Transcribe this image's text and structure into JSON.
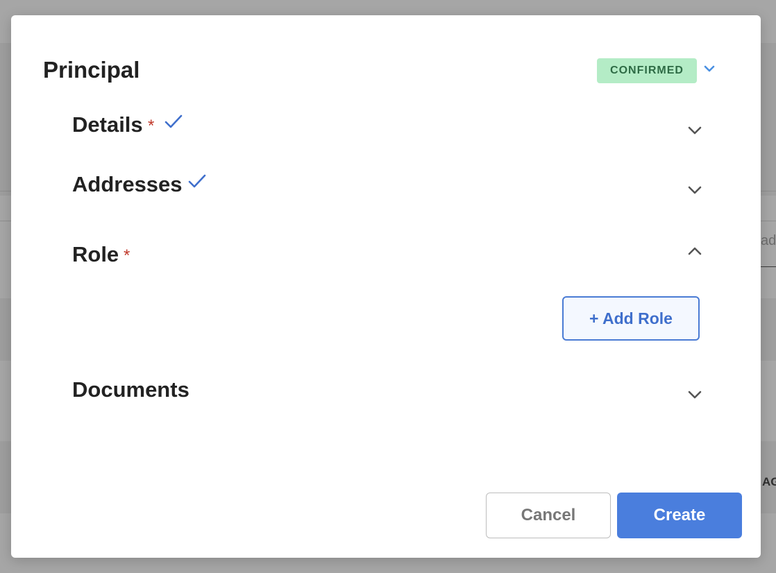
{
  "background": {
    "partial_text_right": "ad",
    "partial_label_right": "AG"
  },
  "modal": {
    "title": "Principal",
    "status": {
      "label": "CONFIRMED",
      "color": "#b4ecc6",
      "text_color": "#2e6b45",
      "icon": "chevron-down-icon"
    },
    "sections": [
      {
        "title": "Details",
        "required": true,
        "required_mark": "*",
        "completed": true,
        "expanded": false
      },
      {
        "title": "Addresses",
        "required": false,
        "completed": true,
        "expanded": false
      },
      {
        "title": "Role",
        "required": true,
        "required_mark": "*",
        "completed": false,
        "expanded": true,
        "add_button_label": "+ Add Role"
      },
      {
        "title": "Documents",
        "required": false,
        "completed": false,
        "expanded": false
      }
    ],
    "footer": {
      "cancel_label": "Cancel",
      "create_label": "Create"
    },
    "accent_color": "#4a7edd",
    "required_color": "#c0392b"
  }
}
